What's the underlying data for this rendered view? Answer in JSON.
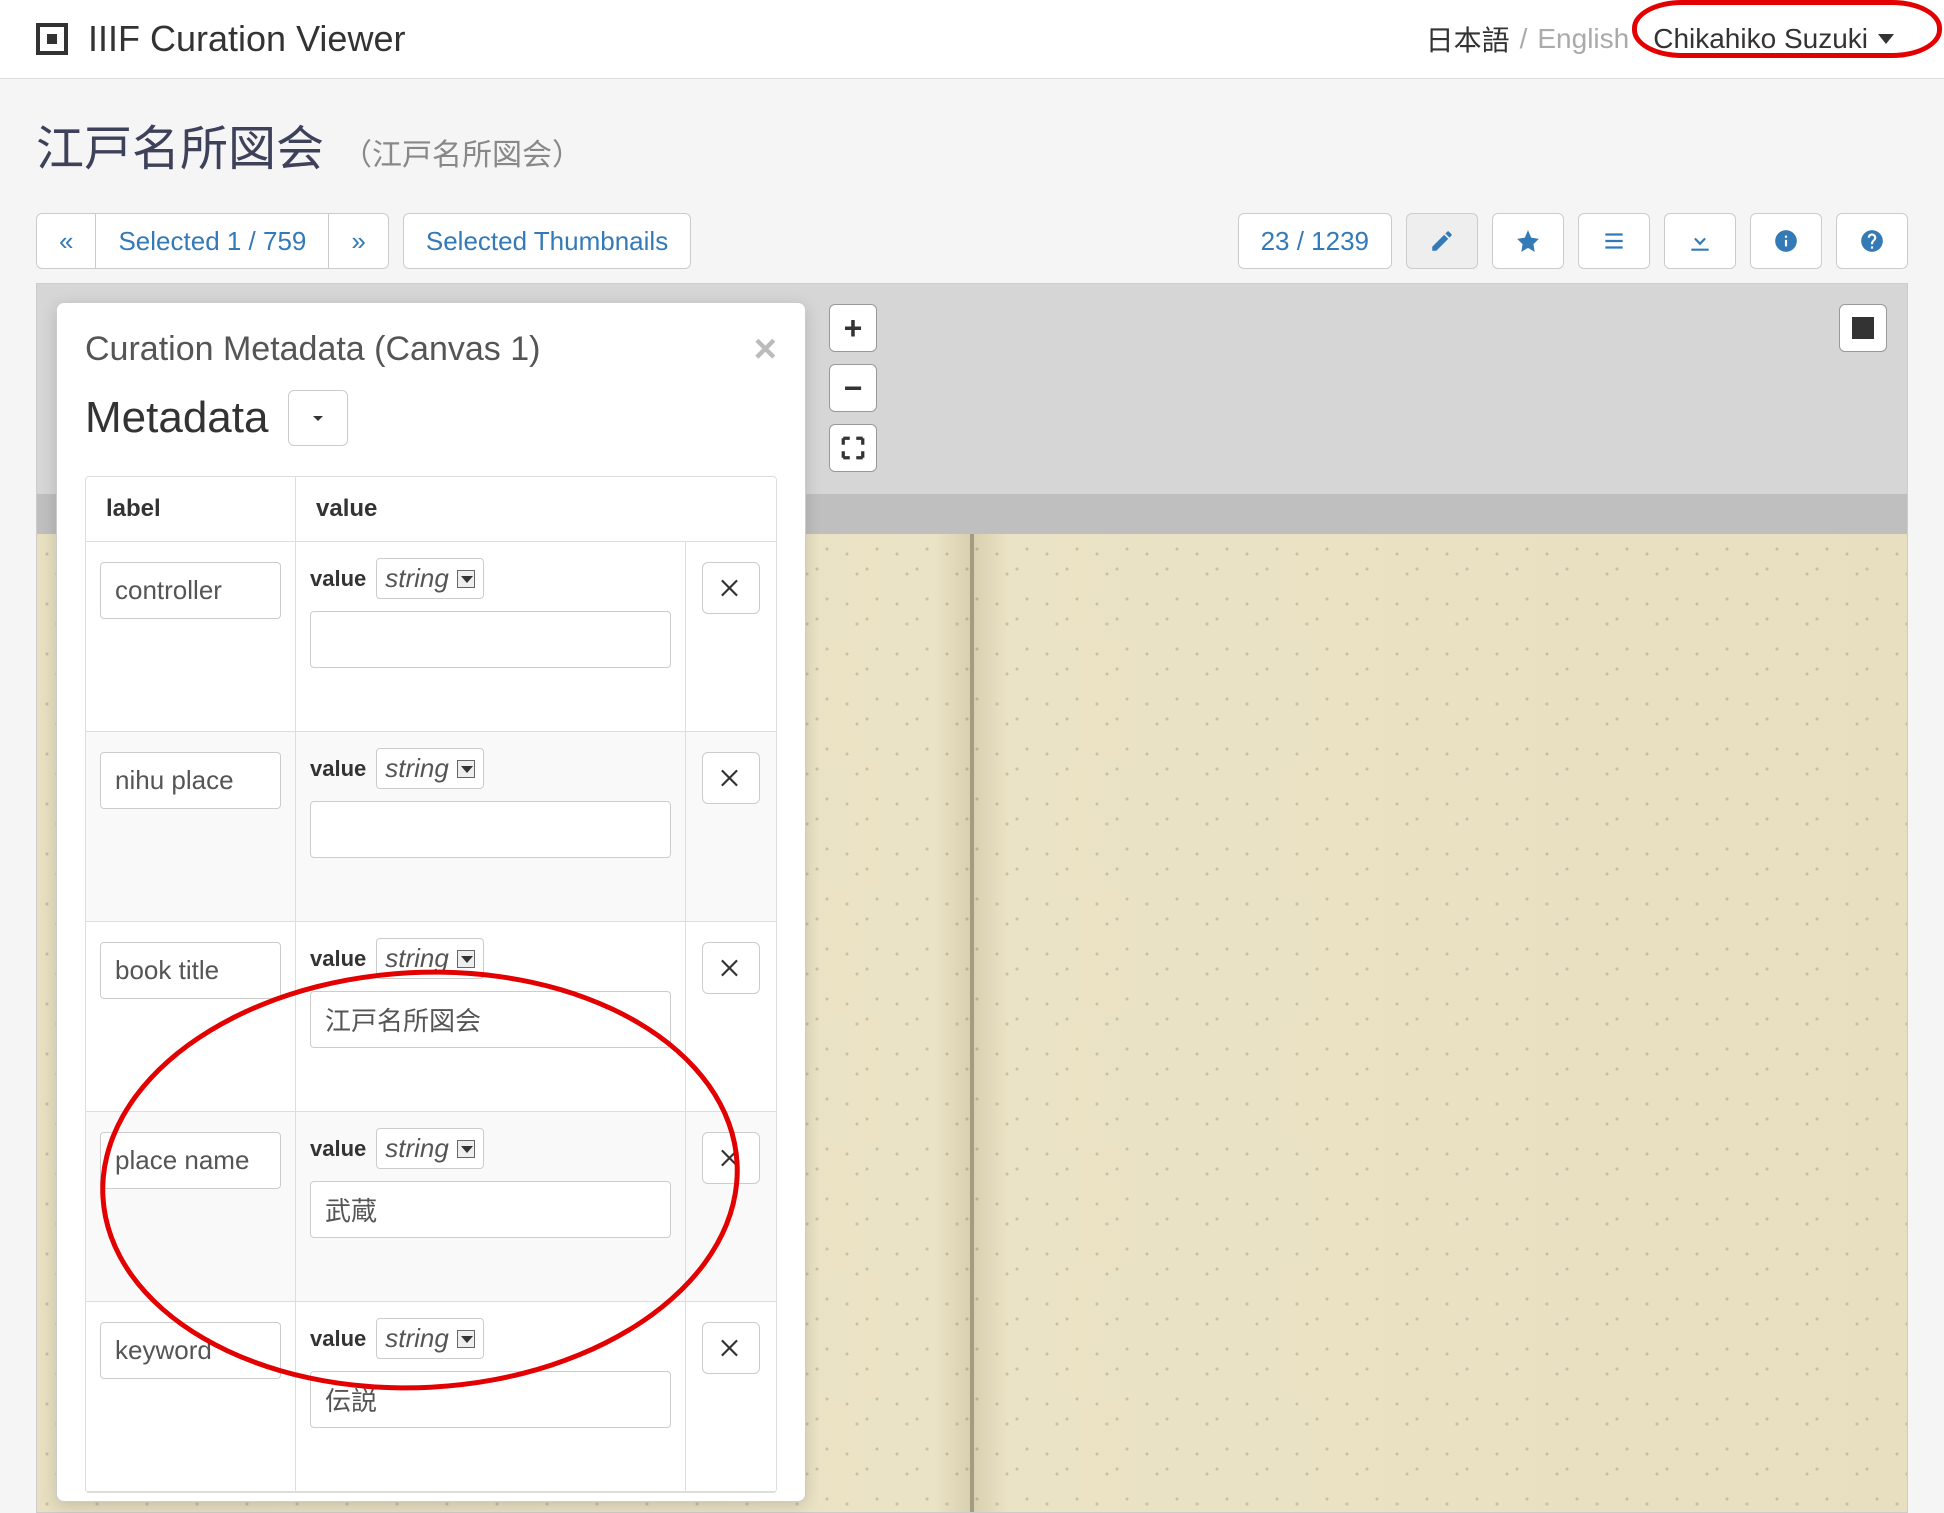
{
  "app": {
    "title": "IIIF Curation Viewer"
  },
  "lang": {
    "jp": "日本語",
    "en": "English",
    "sep": "/"
  },
  "user": {
    "name": "Chikahiko Suzuki"
  },
  "document": {
    "title": "江戸名所図会",
    "subtitle": "（江戸名所図会）"
  },
  "nav": {
    "prev": "«",
    "selected": "Selected  1 / 759",
    "next": "»",
    "thumbnails": "Selected Thumbnails",
    "page": "23 / 1239"
  },
  "viewer": {
    "zoom_in": "+",
    "zoom_out": "−"
  },
  "panel": {
    "title": "Curation Metadata (Canvas 1)",
    "section": "Metadata",
    "thead": {
      "label": "label",
      "value": "value"
    },
    "value_label": "value",
    "type_option": "string"
  },
  "metadata_rows": [
    {
      "label": "controller",
      "value": ""
    },
    {
      "label": "nihu place",
      "value": ""
    },
    {
      "label": "book title",
      "value": "江戸名所図会"
    },
    {
      "label": "place name",
      "value": "武蔵"
    },
    {
      "label": "keyword",
      "value": "伝説"
    }
  ]
}
